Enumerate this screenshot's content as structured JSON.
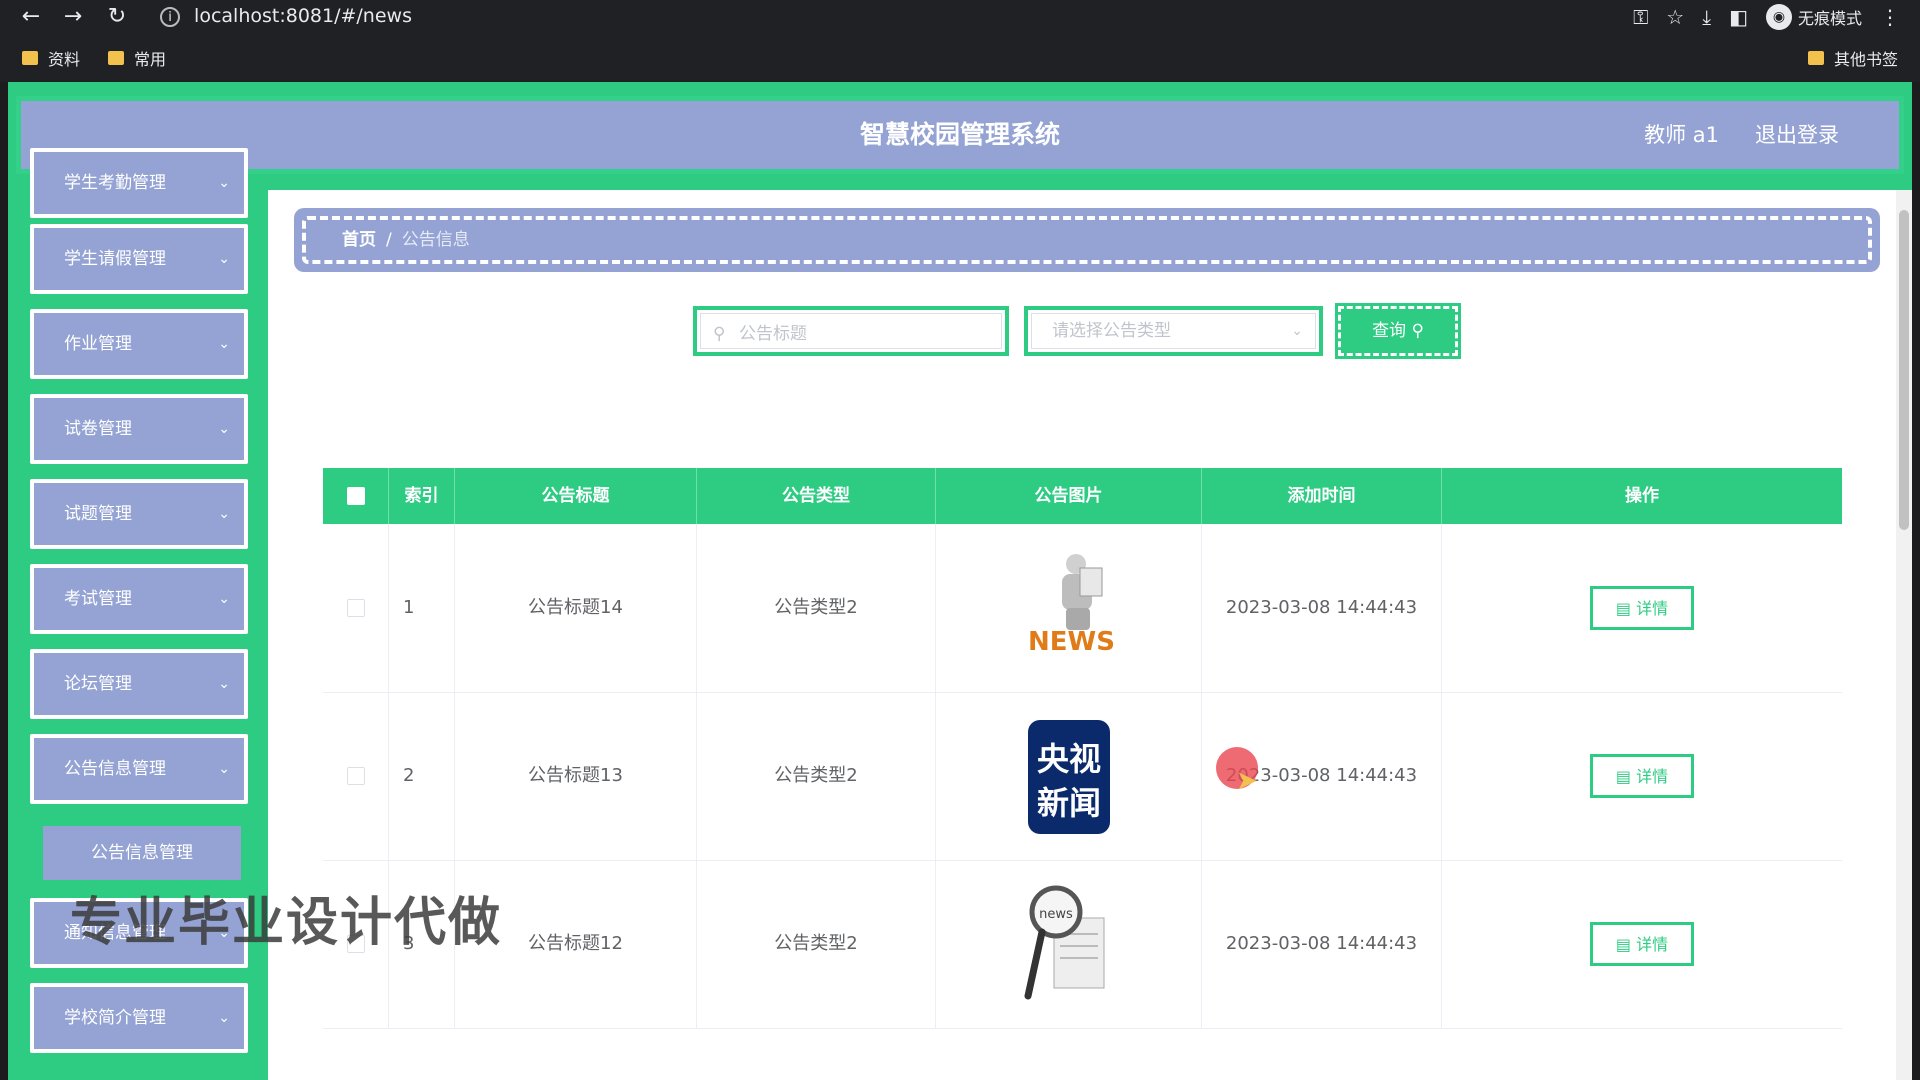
{
  "browser": {
    "url": "localhost:8081/#/news",
    "profile_label": "无痕模式",
    "bookmarks": [
      "资料",
      "常用"
    ],
    "other_bookmarks": "其他书签"
  },
  "header": {
    "title": "智慧校园管理系统",
    "user": "教师 a1",
    "logout": "退出登录"
  },
  "sidebar": {
    "items": [
      {
        "label": "学生考勤管理"
      },
      {
        "label": "学生请假管理"
      },
      {
        "label": "作业管理"
      },
      {
        "label": "试卷管理"
      },
      {
        "label": "试题管理"
      },
      {
        "label": "考试管理"
      },
      {
        "label": "论坛管理"
      },
      {
        "label": "公告信息管理"
      },
      {
        "label": "通知信息管理"
      },
      {
        "label": "学校简介管理"
      }
    ],
    "submenu": {
      "label": "公告信息管理"
    }
  },
  "breadcrumb": {
    "home": "首页",
    "separator": "/",
    "current": "公告信息"
  },
  "search": {
    "title_placeholder": "公告标题",
    "type_placeholder": "请选择公告类型",
    "query_label": "查询"
  },
  "table": {
    "columns": [
      "索引",
      "公告标题",
      "公告类型",
      "公告图片",
      "添加时间",
      "操作"
    ],
    "detail_label": "详情",
    "rows": [
      {
        "index": "1",
        "title": "公告标题14",
        "type": "公告类型2",
        "image": "news-reader-figure",
        "time": "2023-03-08 14:44:43"
      },
      {
        "index": "2",
        "title": "公告标题13",
        "type": "公告类型2",
        "image": "cctv-news-logo",
        "image_text": [
          "央视",
          "新闻"
        ],
        "time": "2023-03-08 14:44:43"
      },
      {
        "index": "3",
        "title": "公告标题12",
        "type": "公告类型2",
        "image": "news-magnifier",
        "time": "2023-03-08 14:44:43"
      }
    ]
  },
  "watermark": "专业毕业设计代做",
  "colors": {
    "accent_green": "#2ecb83",
    "menu_blue": "#94a3d3"
  }
}
